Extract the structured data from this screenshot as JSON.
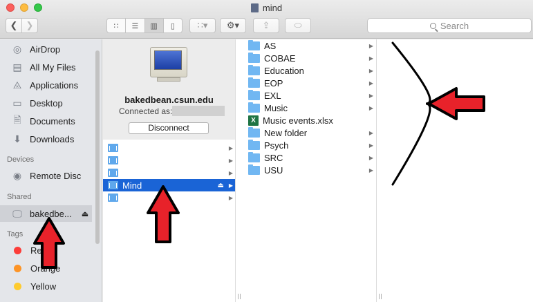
{
  "window": {
    "title": "mind"
  },
  "toolbar": {
    "back_icon": "chevron-left-icon",
    "forward_icon": "chevron-right-icon",
    "search_placeholder": "Search"
  },
  "sidebar": {
    "favorites": [
      {
        "label": "AirDrop",
        "icon": "airdrop-icon"
      },
      {
        "label": "All My Files",
        "icon": "all-files-icon"
      },
      {
        "label": "Applications",
        "icon": "applications-icon"
      },
      {
        "label": "Desktop",
        "icon": "desktop-icon"
      },
      {
        "label": "Documents",
        "icon": "documents-icon"
      },
      {
        "label": "Downloads",
        "icon": "downloads-icon"
      }
    ],
    "devices_heading": "Devices",
    "devices": [
      {
        "label": "Remote Disc",
        "icon": "disc-icon"
      }
    ],
    "shared_heading": "Shared",
    "shared": [
      {
        "label": "bakedbe...",
        "icon": "monitor-icon",
        "selected": true
      }
    ],
    "tags_heading": "Tags",
    "tags": [
      {
        "label": "Red",
        "color": "#fc3d39"
      },
      {
        "label": "Orange",
        "color": "#fd9426"
      },
      {
        "label": "Yellow",
        "color": "#fecb2f"
      }
    ]
  },
  "server": {
    "name": "bakedbean.csun.edu",
    "connected_as_label": "Connected as:",
    "disconnect_label": "Disconnect",
    "shares": [
      {
        "label": "",
        "selected": false
      },
      {
        "label": "",
        "selected": false
      },
      {
        "label": "",
        "selected": false
      },
      {
        "label": "Mind",
        "selected": true
      },
      {
        "label": "",
        "selected": false
      }
    ]
  },
  "folders": [
    {
      "label": "AS",
      "type": "folder"
    },
    {
      "label": "COBAE",
      "type": "folder"
    },
    {
      "label": "Education",
      "type": "folder"
    },
    {
      "label": "EOP",
      "type": "folder"
    },
    {
      "label": "EXL",
      "type": "folder"
    },
    {
      "label": "Music",
      "type": "folder"
    },
    {
      "label": "Music events.xlsx",
      "type": "xlsx"
    },
    {
      "label": "New folder",
      "type": "folder"
    },
    {
      "label": "Psych",
      "type": "folder"
    },
    {
      "label": "SRC",
      "type": "folder"
    },
    {
      "label": "USU",
      "type": "folder"
    }
  ],
  "annotations": {
    "arrow_color": "#e8222a"
  }
}
